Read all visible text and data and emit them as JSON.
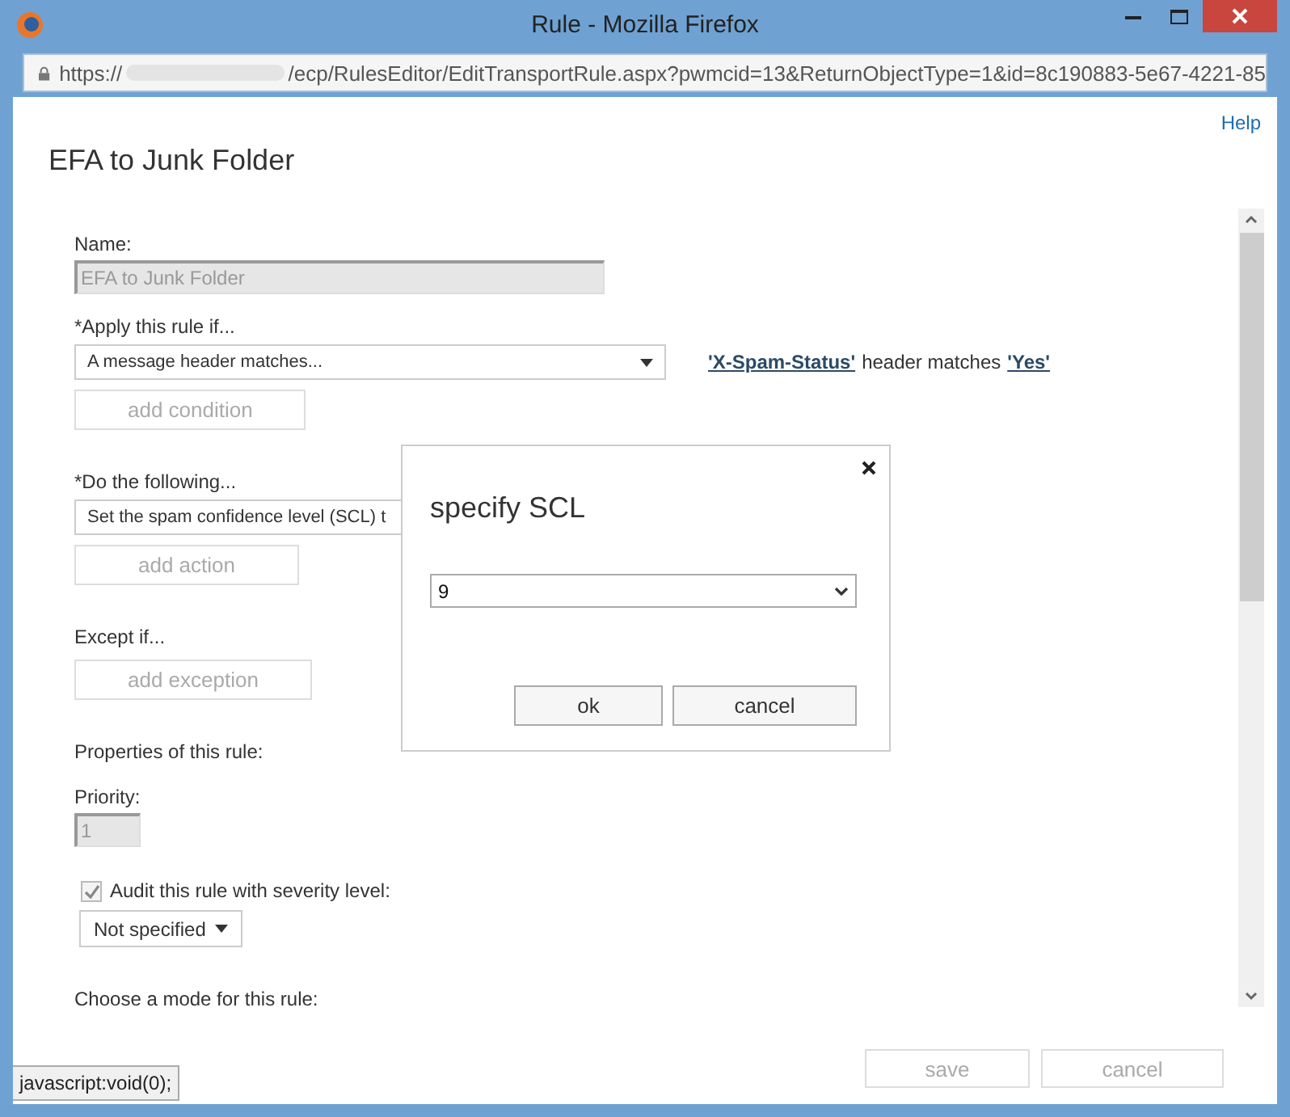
{
  "window": {
    "title": "Rule - Mozilla Firefox"
  },
  "address_bar": {
    "scheme": "https://",
    "path": "/ecp/RulesEditor/EditTransportRule.aspx?pwmcid=13&ReturnObjectType=1&id=8c190883-5e67-4221-85"
  },
  "help_link": "Help",
  "page_title": "EFA to Junk Folder",
  "form": {
    "items": [
      {
        "kind": "label",
        "text": "Name:"
      },
      {
        "kind": "textbox",
        "value": "EFA to Junk Folder",
        "disabled": true
      },
      {
        "kind": "label",
        "text": "*Apply this rule if..."
      },
      {
        "kind": "select",
        "value": "A message header matches...",
        "summary": [
          {
            "kind": "link",
            "text": "'X-Spam-Status'"
          },
          {
            "kind": "text",
            "text": "header matches"
          },
          {
            "kind": "link",
            "text": "'Yes'"
          }
        ]
      },
      {
        "kind": "button",
        "label": "add condition",
        "disabled": true
      },
      {
        "kind": "heading",
        "text": "*Do the following..."
      },
      {
        "kind": "select",
        "value": "Set the spam confidence level (SCL) t"
      },
      {
        "kind": "button",
        "label": "add action",
        "disabled": true
      },
      {
        "kind": "heading",
        "text": "Except if..."
      },
      {
        "kind": "button",
        "label": "add exception",
        "disabled": true
      },
      {
        "kind": "heading",
        "text": "Properties of this rule:"
      },
      {
        "kind": "label",
        "text": "Priority:"
      },
      {
        "kind": "number_box",
        "value": "1",
        "disabled": true
      },
      {
        "kind": "checkbox",
        "label": "Audit this rule with severity level:",
        "checked": true,
        "disabled": true
      },
      {
        "kind": "dropdown",
        "value": "Not specified"
      },
      {
        "kind": "heading",
        "text": "Choose a mode for this rule:"
      }
    ]
  },
  "footer_buttons": [
    {
      "label": "save",
      "disabled": true
    },
    {
      "label": "cancel",
      "disabled": true
    }
  ],
  "dialog": {
    "title": "specify SCL",
    "select_value": "9",
    "buttons": [
      {
        "label": "ok",
        "disabled": false
      },
      {
        "label": "cancel",
        "disabled": false
      }
    ]
  },
  "status_bar": "javascript:void(0);"
}
